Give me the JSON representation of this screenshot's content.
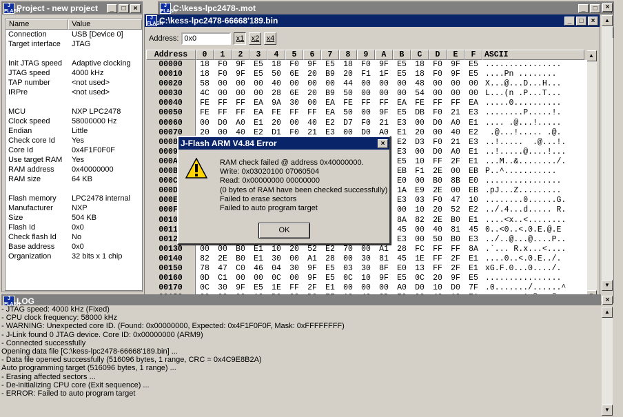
{
  "project": {
    "title": "Project - new project",
    "col_name": "Name",
    "col_value": "Value",
    "rows": [
      {
        "n": "Connection",
        "v": "USB [Device 0]"
      },
      {
        "n": "Target interface",
        "v": "JTAG"
      },
      {
        "n": "",
        "v": ""
      },
      {
        "n": "Init JTAG speed",
        "v": "Adaptive clocking"
      },
      {
        "n": "JTAG speed",
        "v": "4000 kHz"
      },
      {
        "n": "TAP number",
        "v": "<not used>"
      },
      {
        "n": "IRPre",
        "v": "<not used>"
      },
      {
        "n": "",
        "v": ""
      },
      {
        "n": "MCU",
        "v": "NXP LPC2478"
      },
      {
        "n": "Clock speed",
        "v": "58000000 Hz"
      },
      {
        "n": "Endian",
        "v": "Little"
      },
      {
        "n": "Check core Id",
        "v": "Yes"
      },
      {
        "n": "Core Id",
        "v": "0x4F1F0F0F"
      },
      {
        "n": "Use target RAM",
        "v": "Yes"
      },
      {
        "n": "RAM address",
        "v": "0x40000000"
      },
      {
        "n": "RAM size",
        "v": "64 KB"
      },
      {
        "n": "",
        "v": ""
      },
      {
        "n": "Flash memory",
        "v": "LPC2478 internal"
      },
      {
        "n": "Manufacturer",
        "v": "NXP"
      },
      {
        "n": "Size",
        "v": "504 KB"
      },
      {
        "n": "Flash Id",
        "v": "0x0"
      },
      {
        "n": "Check flash Id",
        "v": "No"
      },
      {
        "n": "Base address",
        "v": "0x0"
      },
      {
        "n": "Organization",
        "v": "32 bits x 1 chip"
      }
    ]
  },
  "mot_window": {
    "title": "C:\\kess-lpc2478-.mot"
  },
  "bin_window": {
    "title": "C:\\kess-lpc2478-66668'189.bin",
    "address_label": "Address:",
    "address_value": "0x0",
    "zoom_buttons": [
      "x1",
      "x2",
      "x4"
    ],
    "header": [
      "Address",
      "0",
      "1",
      "2",
      "3",
      "4",
      "5",
      "6",
      "7",
      "8",
      "9",
      "A",
      "B",
      "C",
      "D",
      "E",
      "F",
      "ASCII"
    ],
    "rows": [
      {
        "a": "00000",
        "b": [
          "18",
          "F0",
          "9F",
          "E5",
          "18",
          "F0",
          "9F",
          "E5",
          "18",
          "F0",
          "9F",
          "E5",
          "18",
          "F0",
          "9F",
          "E5"
        ],
        "s": "................"
      },
      {
        "a": "00010",
        "b": [
          "18",
          "F0",
          "9F",
          "E5",
          "50",
          "6E",
          "20",
          "B9",
          "20",
          "F1",
          "1F",
          "E5",
          "18",
          "F0",
          "9F",
          "E5"
        ],
        "s": "....Pn ........"
      },
      {
        "a": "00020",
        "b": [
          "58",
          "00",
          "00",
          "00",
          "40",
          "00",
          "00",
          "00",
          "44",
          "00",
          "00",
          "00",
          "48",
          "00",
          "00",
          "00"
        ],
        "s": "X...@...D...H..."
      },
      {
        "a": "00030",
        "b": [
          "4C",
          "00",
          "00",
          "00",
          "28",
          "6E",
          "20",
          "B9",
          "50",
          "00",
          "00",
          "00",
          "54",
          "00",
          "00",
          "00"
        ],
        "s": "L...(n .P...T..."
      },
      {
        "a": "00040",
        "b": [
          "FE",
          "FF",
          "FF",
          "EA",
          "9A",
          "30",
          "00",
          "EA",
          "FE",
          "FF",
          "FF",
          "EA",
          "FE",
          "FF",
          "FF",
          "EA"
        ],
        "s": ".....0.........."
      },
      {
        "a": "00050",
        "b": [
          "FE",
          "FF",
          "FF",
          "EA",
          "FE",
          "FF",
          "FF",
          "EA",
          "50",
          "00",
          "9F",
          "E5",
          "DB",
          "F0",
          "21",
          "E3"
        ],
        "s": "........P.....!."
      },
      {
        "a": "00060",
        "b": [
          "00",
          "D0",
          "A0",
          "E1",
          "20",
          "00",
          "40",
          "E2",
          "D7",
          "F0",
          "21",
          "E3",
          "00",
          "D0",
          "A0",
          "E1"
        ],
        "s": ".... .@...!....."
      },
      {
        "a": "00070",
        "b": [
          "20",
          "00",
          "40",
          "E2",
          "D1",
          "F0",
          "21",
          "E3",
          "00",
          "D0",
          "A0",
          "E1",
          "20",
          "00",
          "40",
          "E2"
        ],
        "s": " .@...!..... .@."
      },
      {
        "a": "00080",
        "b": [
          "",
          "",
          "",
          "",
          "",
          "",
          "",
          "",
          "",
          "",
          "",
          "E2",
          "D3",
          "F0",
          "21",
          "E3"
        ],
        "s": "..!.....  .@...!."
      },
      {
        "a": "00090",
        "b": [
          "",
          "",
          "",
          "",
          "",
          "",
          "",
          "",
          "",
          "",
          "",
          "E3",
          "00",
          "D0",
          "A0",
          "E1"
        ],
        "s": "..!.....@....!..."
      },
      {
        "a": "000A0",
        "b": [
          "",
          "",
          "",
          "",
          "",
          "",
          "",
          "",
          "",
          "",
          "",
          "E5",
          "10",
          "FF",
          "2F",
          "E1"
        ],
        "s": "...M..&......../."
      },
      {
        "a": "000B0",
        "b": [
          "",
          "",
          "",
          "",
          "",
          "",
          "",
          "",
          "",
          "",
          "",
          "EB",
          "F1",
          "2E",
          "00",
          "EB"
        ],
        "s": "P..^..........."
      },
      {
        "a": "000C0",
        "b": [
          "",
          "",
          "",
          "",
          "",
          "",
          "",
          "",
          "",
          "",
          "",
          "E0",
          "00",
          "B0",
          "8B",
          "E0"
        ],
        "s": "................"
      },
      {
        "a": "000D0",
        "b": [
          "",
          "",
          "",
          "",
          "",
          "",
          "",
          "",
          "",
          "",
          "",
          "1A",
          "E9",
          "2E",
          "00",
          "EB"
        ],
        "s": ".pJ...Z........."
      },
      {
        "a": "000E0",
        "b": [
          "",
          "",
          "",
          "",
          "",
          "",
          "",
          "",
          "",
          "",
          "",
          "E3",
          "03",
          "F0",
          "47",
          "10"
        ],
        "s": "........0......G."
      },
      {
        "a": "000F0",
        "b": [
          "",
          "",
          "",
          "",
          "",
          "",
          "",
          "",
          "",
          "",
          "",
          "00",
          "10",
          "20",
          "52",
          "E2"
        ],
        "s": "../.4...d..... R."
      },
      {
        "a": "00100",
        "b": [
          "",
          "",
          "",
          "",
          "",
          "",
          "",
          "",
          "",
          "",
          "",
          "8A",
          "82",
          "2E",
          "B0",
          "E1"
        ],
        "s": "....<x..<........"
      },
      {
        "a": "00110",
        "b": [
          "",
          "",
          "",
          "",
          "",
          "",
          "",
          "",
          "",
          "",
          "",
          "45",
          "00",
          "40",
          "81",
          "45"
        ],
        "s": "0..<0..<.0.E.@.E"
      },
      {
        "a": "00120",
        "b": [
          "",
          "",
          "",
          "",
          "",
          "",
          "",
          "",
          "",
          "",
          "",
          "E3",
          "00",
          "50",
          "B0",
          "E3"
        ],
        "s": "../..@...@....P.."
      },
      {
        "a": "00130",
        "b": [
          "00",
          "00",
          "B0",
          "E1",
          "10",
          "20",
          "52",
          "E2",
          "70",
          "00",
          "A1",
          "28",
          "FC",
          "FF",
          "FF",
          "8A"
        ],
        "s": ".`... R.x...<...."
      },
      {
        "a": "00140",
        "b": [
          "82",
          "2E",
          "B0",
          "E1",
          "30",
          "00",
          "A1",
          "28",
          "00",
          "30",
          "81",
          "45",
          "1E",
          "FF",
          "2F",
          "E1"
        ],
        "s": "....0..<.0.E../."
      },
      {
        "a": "00150",
        "b": [
          "78",
          "47",
          "C0",
          "46",
          "04",
          "30",
          "9F",
          "E5",
          "03",
          "30",
          "8F",
          "E0",
          "13",
          "FF",
          "2F",
          "E1"
        ],
        "s": "xG.F.0...0..../."
      },
      {
        "a": "00160",
        "b": [
          "0D",
          "C1",
          "00",
          "00",
          "0C",
          "00",
          "9F",
          "E5",
          "0C",
          "10",
          "9F",
          "E5",
          "0C",
          "20",
          "9F",
          "E5"
        ],
        "s": "................"
      },
      {
        "a": "00170",
        "b": [
          "0C",
          "30",
          "9F",
          "E5",
          "1E",
          "FF",
          "2F",
          "E1",
          "00",
          "00",
          "00",
          "A0",
          "D0",
          "10",
          "D0",
          "7F"
        ],
        "s": ".0......./......^"
      },
      {
        "a": "00180",
        "b": [
          "00",
          "00",
          "00",
          "A2",
          "D0",
          "00",
          "D0",
          "7F",
          "10",
          "40",
          "2D",
          "E9",
          "00",
          "40",
          "A0",
          "E1"
        ],
        "s": "........^.@-..@.."
      }
    ]
  },
  "log": {
    "title": "LOG",
    "lines": [
      " - JTAG speed: 4000 kHz (Fixed)",
      " - CPU clock frequency: 58000 kHz",
      " - WARNING: Unexpected core ID. (Found: 0x00000000, Expected: 0x4F1F0F0F, Mask: 0xFFFFFFFF)",
      " - J-Link found 0 JTAG device. Core ID: 0x00000000 (ARM9)",
      " - Connected successfully",
      "Opening data file [C:\\kess-lpc2478-66668'189.bin] ...",
      " - Data file opened successfully (516096 bytes, 1 range, CRC = 0x4C9E8B2A)",
      "Auto programming target (516096 bytes, 1 range) ...",
      " - Erasing affected sectors ...",
      " - De-initializing CPU core (Exit sequence) ...",
      " - ERROR: Failed to auto program target"
    ]
  },
  "dialog": {
    "title": "J-Flash ARM V4.84 Error",
    "lines": [
      "RAM check failed @ address 0x40000000.",
      "Write: 0x03020100 07060504",
      "Read: 0x00000000 00000000",
      "(0 bytes of RAM have been checked successfully)",
      "Failed to erase sectors",
      "Failed to auto program target"
    ],
    "ok_label": "OK"
  }
}
